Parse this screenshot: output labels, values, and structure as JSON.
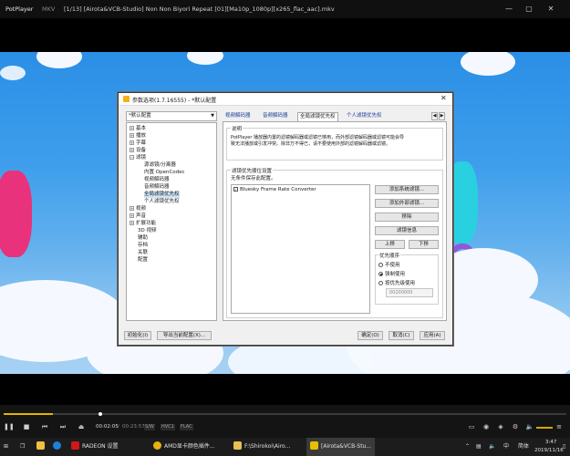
{
  "player": {
    "app_name": "PotPlayer",
    "format": "MKV",
    "file_title": "[1/13] [Airota&VCB-Studio] Non Non Biyori Repeat [01][Ma10p_1080p][x265_flac_aac].mkv"
  },
  "dialog": {
    "title": "参数选项(1.7.16555) - *默认配置",
    "preset": "*默认配置",
    "tree": [
      {
        "label": "基本",
        "box": "+"
      },
      {
        "label": "播放",
        "box": "+"
      },
      {
        "label": "字幕",
        "box": "+"
      },
      {
        "label": "设备",
        "box": "+"
      },
      {
        "label": "滤镜",
        "box": "−"
      },
      {
        "label": "源滤镜/分离器",
        "box": ""
      },
      {
        "label": "内置 OpenCodec",
        "box": ""
      },
      {
        "label": "视频解码器",
        "box": ""
      },
      {
        "label": "音频解码器",
        "box": ""
      },
      {
        "label": "全局滤镜优先权",
        "box": ""
      },
      {
        "label": "个人滤镜优先权",
        "box": ""
      },
      {
        "label": "视频",
        "box": "+"
      },
      {
        "label": "声音",
        "box": "+"
      },
      {
        "label": "扩展功能",
        "box": "+"
      },
      {
        "label": "3D 视频",
        "box": ""
      },
      {
        "label": "辅助",
        "box": ""
      },
      {
        "label": "存档",
        "box": ""
      },
      {
        "label": "关联",
        "box": ""
      },
      {
        "label": "配置",
        "box": ""
      }
    ],
    "tabs": [
      "视频解码器",
      "音频解码器",
      "全局滤镜优先权",
      "个人滤镜优先权"
    ],
    "desc_title": "说明",
    "desc_text_1": "PotPlayer 播放器内置的滤镜解码器或滤镜已够用，而外部滤镜解码器或滤镜可能会导",
    "desc_text_2": "致无法播放或引发冲突。除非万不得已，请不要使用外部的滤镜解码器或滤镜。",
    "priority_title": "滤镜优先顺位设置",
    "priority_sub": "无条件保存此配置。",
    "filter_items": [
      "Bluesky Frame Rate Converter"
    ],
    "buttons": {
      "add_system": "添加系统滤镜...",
      "add_external": "添加外部滤镜...",
      "remove": "移除",
      "filter_info": "滤镜信息",
      "up": "上移",
      "down": "下移"
    },
    "order_title": "优先顺序",
    "order_options": [
      "不使用",
      "强制使用",
      "按优先级使用"
    ],
    "order_value": "00200000",
    "footer": {
      "init": "初始化(I)",
      "export": "导出当前配置(X)...",
      "ok": "确定(O)",
      "cancel": "取消(C)",
      "apply": "应用(A)"
    }
  },
  "controls": {
    "time_current": "00:02:05",
    "time_total": "00:23:57",
    "tags": [
      "S/W",
      "HVC1",
      "FLAC"
    ],
    "progress_fraction": 0.087
  },
  "taskbar": {
    "items": [
      "RADEON 设置",
      "AMD显卡颜色插件...",
      "F:\\Shirokoi\\Airo...",
      "[Airota&VCB-Stu..."
    ],
    "lang": "简体",
    "time": "3:47",
    "date": "2019/11/16"
  }
}
